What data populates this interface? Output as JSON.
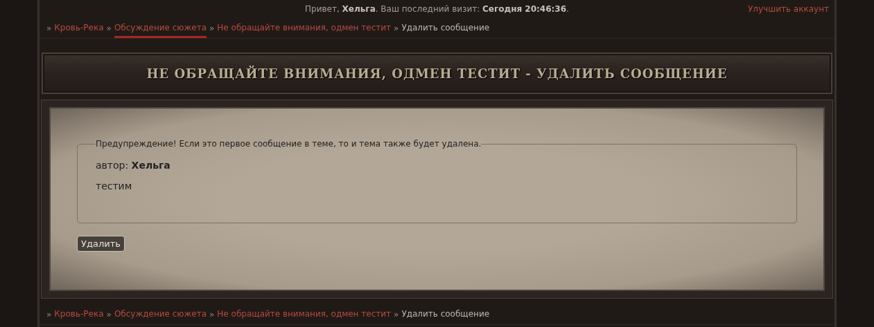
{
  "header": {
    "welcome": "Привет, **Хельга**. Ваш последний визит: **Сегодня 20:46:36**.",
    "upgrade_link": "Улучшить аккаунт"
  },
  "breadcrumbs_top": [
    {
      "separator": "»",
      "label": "Кровь-Река",
      "kind": "link",
      "selected": false
    },
    {
      "separator": "»",
      "label": "Обсуждение сюжета",
      "kind": "link",
      "selected": true
    },
    {
      "separator": "»",
      "label": "Не обращайте внимания, одмен тестит",
      "kind": "link",
      "selected": false
    },
    {
      "separator": "»",
      "label": "Удалить сообщение",
      "kind": "current",
      "selected": false
    }
  ],
  "page_title": "НЕ ОБРАЩАЙТЕ ВНИМАНИЯ, ОДМЕН ТЕСТИТ - УДАЛИТЬ СООБЩЕНИЕ",
  "form": {
    "legend": "Предупреждение! Если это первое сообщение в теме, то и тема также будет удалена.",
    "author_label": "автор:",
    "author": "Хельга",
    "message": "тестим",
    "button": "Удалить"
  },
  "breadcrumbs_bottom": [
    {
      "separator": "»",
      "label": "Кровь-Река",
      "kind": "link"
    },
    {
      "separator": "»",
      "label": "Обсуждение сюжета",
      "kind": "link"
    },
    {
      "separator": "»",
      "label": "Не обращайте внимания, одмен тестит",
      "kind": "link"
    },
    {
      "separator": "»",
      "label": "Удалить сообщение",
      "kind": "current"
    }
  ]
}
